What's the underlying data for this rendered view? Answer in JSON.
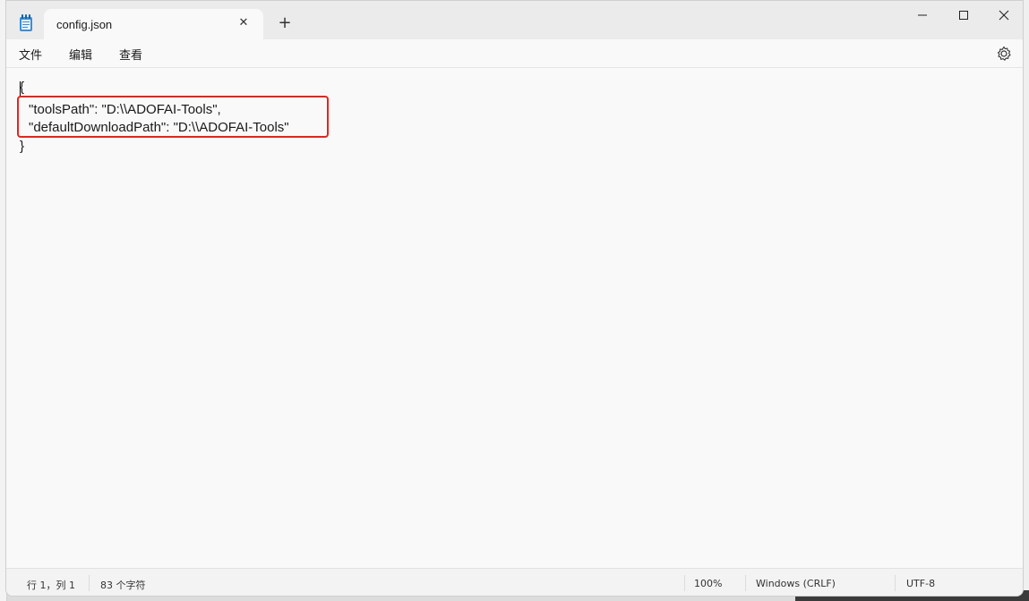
{
  "window": {
    "tab_title": "config.json",
    "tab_close_glyph": "✕",
    "new_tab_glyph": "+",
    "controls": {
      "minimize": "minimize-icon",
      "maximize": "maximize-icon",
      "close": "close-icon"
    }
  },
  "menu": {
    "file": "文件",
    "edit": "编辑",
    "view": "查看",
    "settings_icon": "gear-icon"
  },
  "editor": {
    "lines": [
      "{",
      "\"toolsPath\": \"D:\\\\ADOFAI-Tools\",",
      "\"defaultDownloadPath\": \"D:\\\\ADOFAI-Tools\"",
      "}"
    ],
    "highlight_color": "#e8231b"
  },
  "status": {
    "position": "行 1，列 1",
    "char_count": "83 个字符",
    "zoom": "100%",
    "line_ending": "Windows (CRLF)",
    "encoding": "UTF-8"
  }
}
